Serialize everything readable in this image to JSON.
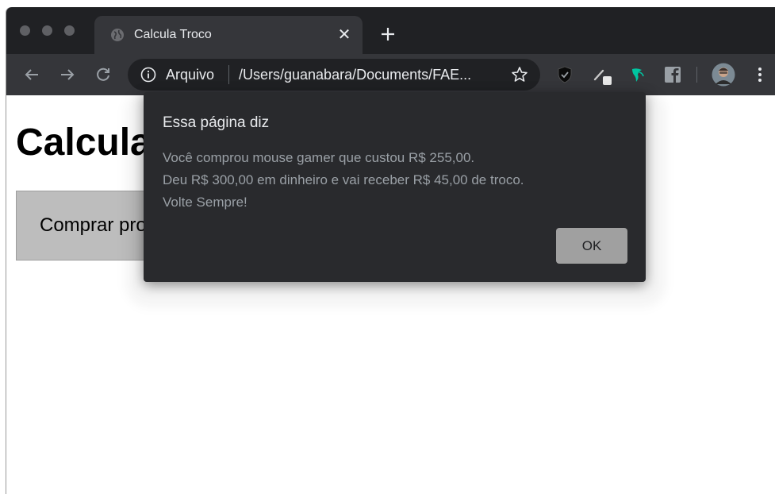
{
  "browser": {
    "tab": {
      "title": "Calcula Troco"
    },
    "address": {
      "scheme_label": "Arquivo",
      "url": "/Users/guanabara/Documents/FAE..."
    }
  },
  "page": {
    "title": "Calcula Troco",
    "button_label": "Comprar produto"
  },
  "dialog": {
    "title": "Essa página diz",
    "lines": [
      "Você comprou mouse gamer que custou R$ 255,00.",
      "Deu R$ 300,00 em dinheiro e vai receber R$ 45,00 de troco.",
      "Volte Sempre!"
    ],
    "ok_label": "OK"
  },
  "colors": {
    "tab_strip": "#202124",
    "toolbar": "#35363a",
    "dialog_bg": "#292a2d",
    "dialog_button": "#a0a0a0",
    "extension_teal": "#00c4a0"
  },
  "icons": {
    "tab": "globe-icon",
    "toolbar": [
      "back-arrow-icon",
      "forward-arrow-icon",
      "reload-icon",
      "info-icon",
      "star-icon"
    ],
    "extensions": [
      "shield-extension-icon",
      "pen-extension-icon",
      "teal-bird-extension-icon",
      "facebook-extension-icon",
      "profile-avatar",
      "menu-dots-icon"
    ]
  }
}
